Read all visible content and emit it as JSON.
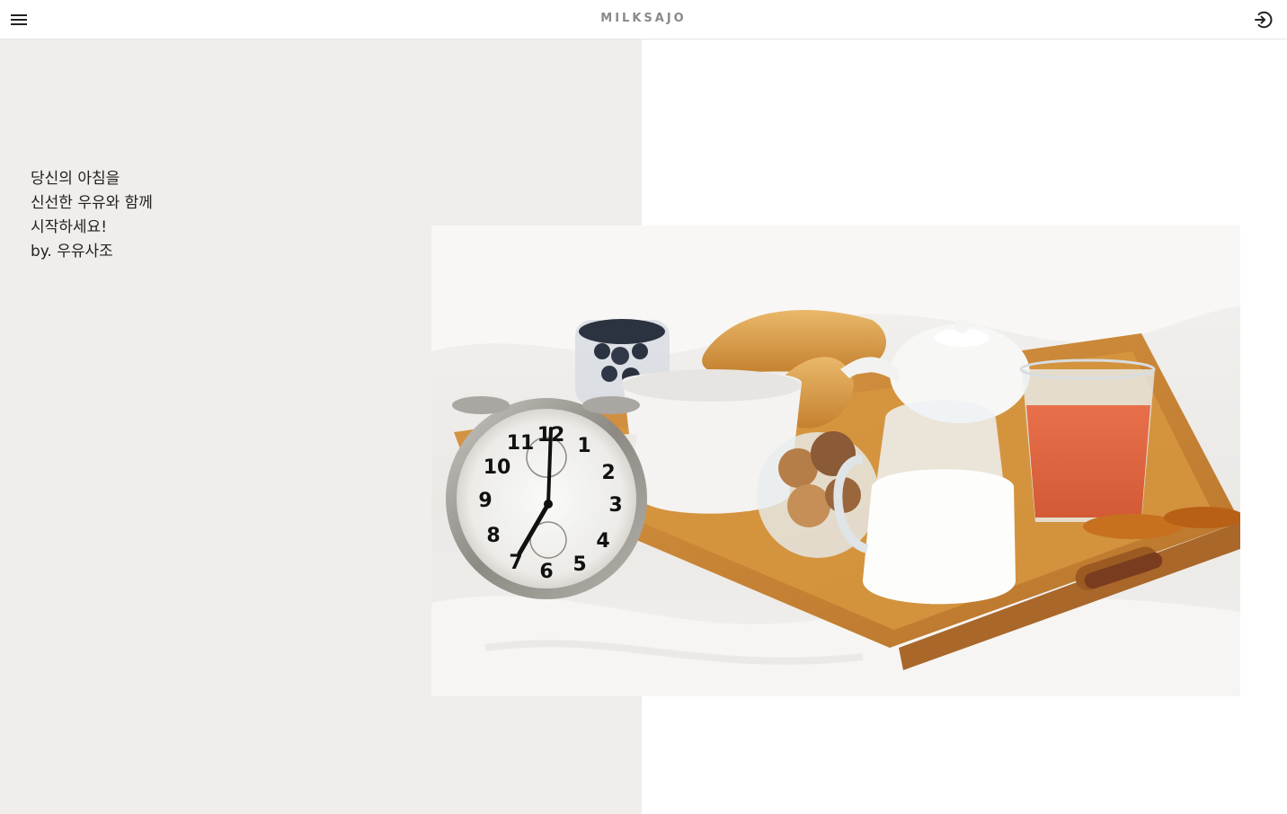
{
  "header": {
    "brand": "MILKSAJO",
    "menu_icon": "hamburger-menu-icon",
    "login_icon": "login-arrow-circle-icon"
  },
  "hero": {
    "tagline_lines": [
      "당신의 아침을",
      "신선한 우유와 함께",
      "시작하세요!",
      "by. 우유사조"
    ],
    "image_subject": "breakfast-tray-alarm-clock-photo",
    "clock_numbers": [
      "12",
      "1",
      "2",
      "3",
      "4",
      "5",
      "6",
      "7",
      "8",
      "9",
      "10",
      "11"
    ]
  },
  "colors": {
    "panel_bg": "#f0edeb",
    "brand_text": "#8a8a8a",
    "header_border": "#e6e6e6"
  }
}
